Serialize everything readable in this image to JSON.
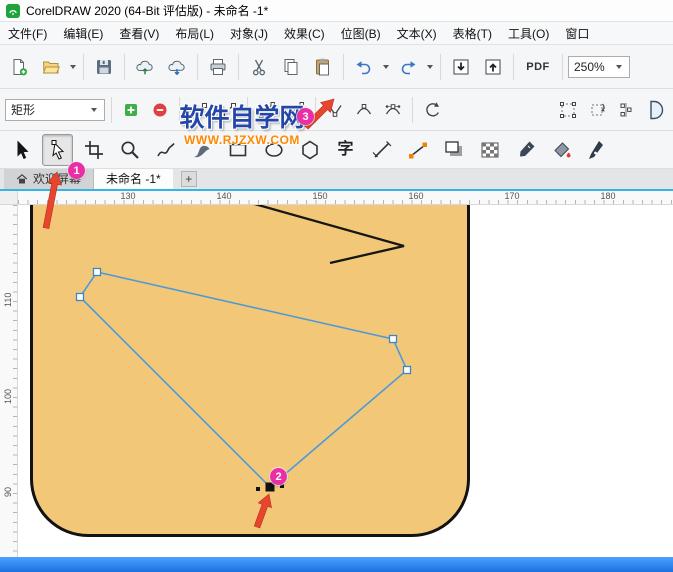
{
  "window": {
    "title": "CorelDRAW 2020 (64-Bit 评估版) - 未命名 -1*"
  },
  "menu": {
    "items": [
      {
        "label": "文件(F)"
      },
      {
        "label": "编辑(E)"
      },
      {
        "label": "查看(V)"
      },
      {
        "label": "布局(L)"
      },
      {
        "label": "对象(J)"
      },
      {
        "label": "效果(C)"
      },
      {
        "label": "位图(B)"
      },
      {
        "label": "文本(X)"
      },
      {
        "label": "表格(T)"
      },
      {
        "label": "工具(O)"
      },
      {
        "label": "窗口"
      }
    ]
  },
  "standard_toolbar": {
    "zoom_level": "250%",
    "pdf_label": "PDF"
  },
  "property_bar": {
    "preset_value": "矩形"
  },
  "toolbox": {
    "text_tool_label": "字"
  },
  "document_tabs": {
    "welcome_tab": "欢迎屏幕",
    "active_tab": "未命名 -1*",
    "new_tab_button": "+"
  },
  "rulers": {
    "horizontal_labels": [
      "130",
      "140",
      "150",
      "160",
      "170",
      "180"
    ],
    "vertical_labels": [
      "110",
      "100",
      "90"
    ]
  },
  "watermark": {
    "site_name": "软件自学网",
    "site_url": "WWW.RJZXW.COM"
  },
  "annotations": {
    "step_1": "1",
    "step_2": "2",
    "step_3": "3"
  },
  "colors": {
    "badge_pink": "#ea2fa6",
    "arrow_red": "#e8452e",
    "shape_fill": "#f2c878",
    "selection_blue": "#4f9ad6",
    "bottom_bar_blue": "#2e7fe0",
    "watermark_blue": "#2446a8",
    "watermark_orange": "#ff8800",
    "logo_green": "#1fa33c"
  },
  "icons": {
    "app-logo-icon": "green balloon logo",
    "new-document-icon": "page with green plus",
    "open-icon": "folder",
    "save-icon": "floppy disk",
    "cloud-upload-icon": "cloud with up arrow",
    "cloud-download-icon": "cloud with down arrow",
    "print-icon": "printer",
    "cut-icon": "scissors",
    "copy-icon": "two pages",
    "paste-icon": "clipboard",
    "undo-icon": "arc arrow left",
    "redo-icon": "arc arrow right",
    "import-icon": "box with down arrow",
    "export-icon": "box with up arrow",
    "add-node-icon": "green plus square",
    "delete-node-icon": "red minus circle",
    "join-nodes-icon": "two nodes joined by line",
    "break-curve-icon": "two nodes with gap",
    "convert-to-line-icon": "straight segment with nodes",
    "convert-to-curve-icon": "curve segment with nodes",
    "cusp-node-icon": "angled segment with node",
    "smooth-node-icon": "smooth arc with node",
    "symmetrical-node-icon": "arc with equal handles",
    "reverse-direction-icon": "arc with arrowheads",
    "close-curve-icon": "D shape",
    "pick-tool-icon": "black arrow cursor",
    "shape-tool-icon": "white arrow with node",
    "crop-tool-icon": "crop blades",
    "zoom-tool-icon": "magnifier",
    "freehand-tool-icon": "squiggle line",
    "artistic-media-tool-icon": "brush stroke",
    "rectangle-tool-icon": "rectangle outline",
    "ellipse-tool-icon": "ellipse outline",
    "polygon-tool-icon": "hexagon outline",
    "dimension-tool-icon": "slanted measured line",
    "connector-tool-icon": "line with orange endpoints",
    "shadow-tool-icon": "offset squares",
    "transparency-tool-icon": "checkerboard",
    "eyedropper-tool-icon": "dropper",
    "interactive-fill-icon": "paint bucket with red drip",
    "outline-pen-icon": "pen nib",
    "home-icon": "house",
    "chevron-down-icon": "▾"
  }
}
